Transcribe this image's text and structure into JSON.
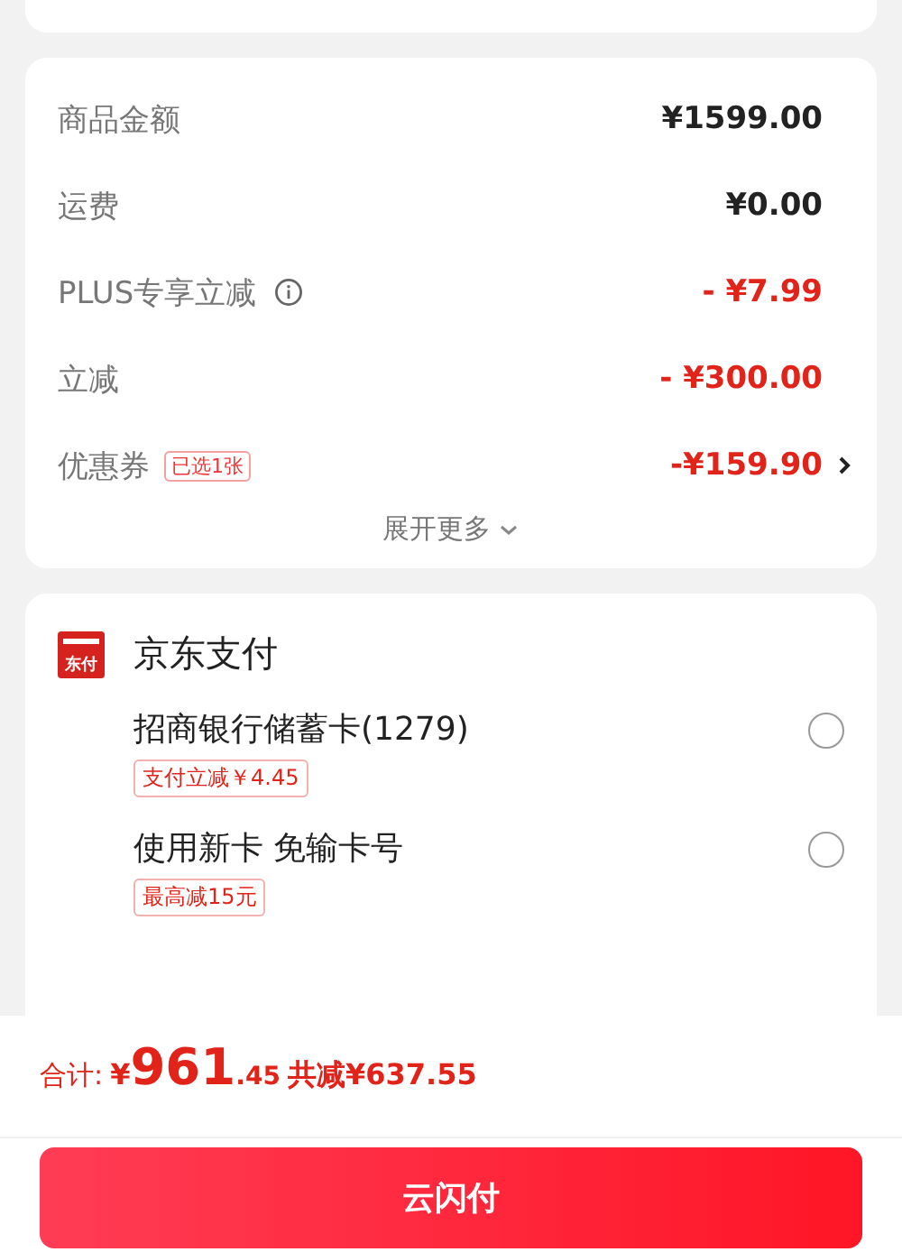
{
  "fees": [
    {
      "label": "商品金额",
      "value": "¥1599.00",
      "kind": "charge"
    },
    {
      "label": "运费",
      "value": "¥0.00",
      "kind": "charge"
    },
    {
      "label": "PLUS专享立减",
      "value": "- ¥7.99",
      "kind": "discount",
      "info": true
    },
    {
      "label": "立减",
      "value": "- ¥300.00",
      "kind": "discount"
    },
    {
      "label": "优惠券",
      "value": "-¥159.90",
      "kind": "discount",
      "badge": "已选1张",
      "chevron": true
    }
  ],
  "expand": "展开更多",
  "payment": {
    "logo": "东付",
    "title": "京东支付",
    "options": [
      {
        "name": "招商银行储蓄卡(1279)",
        "tag": "支付立减￥4.45",
        "selected": false
      },
      {
        "name": "使用新卡 免输卡号",
        "tag": "最高减15元",
        "selected": false
      }
    ]
  },
  "total": {
    "label": "合计:",
    "currency": "¥",
    "integer": "961",
    "decimal": ".45",
    "saving": "共减¥637.55"
  },
  "pay_button": "云闪付"
}
